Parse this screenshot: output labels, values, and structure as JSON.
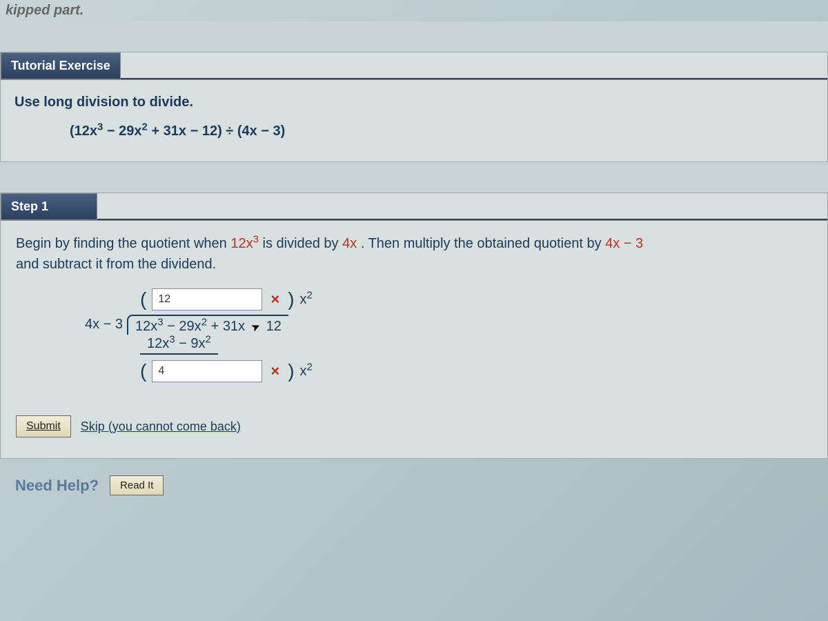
{
  "top": {
    "skipped_label": "kipped part."
  },
  "tutorial": {
    "header": "Tutorial Exercise",
    "instruction": "Use long division to divide.",
    "expression_parts": {
      "open": "(12x",
      "sup1": "3",
      "t1": " − 29x",
      "sup2": "2",
      "t2": " + 31x − 12) ÷ (4x − 3)"
    }
  },
  "step1": {
    "header": "Step 1",
    "text_pre": "Begin by finding the quotient when ",
    "red1": "12x",
    "red1_sup": "3",
    "text_mid1": " is divided by ",
    "red2": "4x",
    "text_mid2": ". Then multiply the obtained quotient by ",
    "red3": "4x − 3",
    "text_end": "and subtract it from the dividend.",
    "input1_value": "12",
    "times_symbol": "×",
    "x2_label": "x",
    "x2_sup": "2",
    "divisor": "4x − 3",
    "dividend_a": "12x",
    "dividend_a_sup": "3",
    "dividend_b": " − 29x",
    "dividend_b_sup": "2",
    "dividend_c": " + 31x",
    "dividend_d": "12",
    "sub_a": "12x",
    "sub_a_sup": "3",
    "sub_b": " − 9x",
    "sub_b_sup": "2",
    "input2_value": "4"
  },
  "controls": {
    "submit": "Submit",
    "skip": "Skip (you cannot come back)"
  },
  "help": {
    "label": "Need Help?",
    "readit": "Read It"
  }
}
